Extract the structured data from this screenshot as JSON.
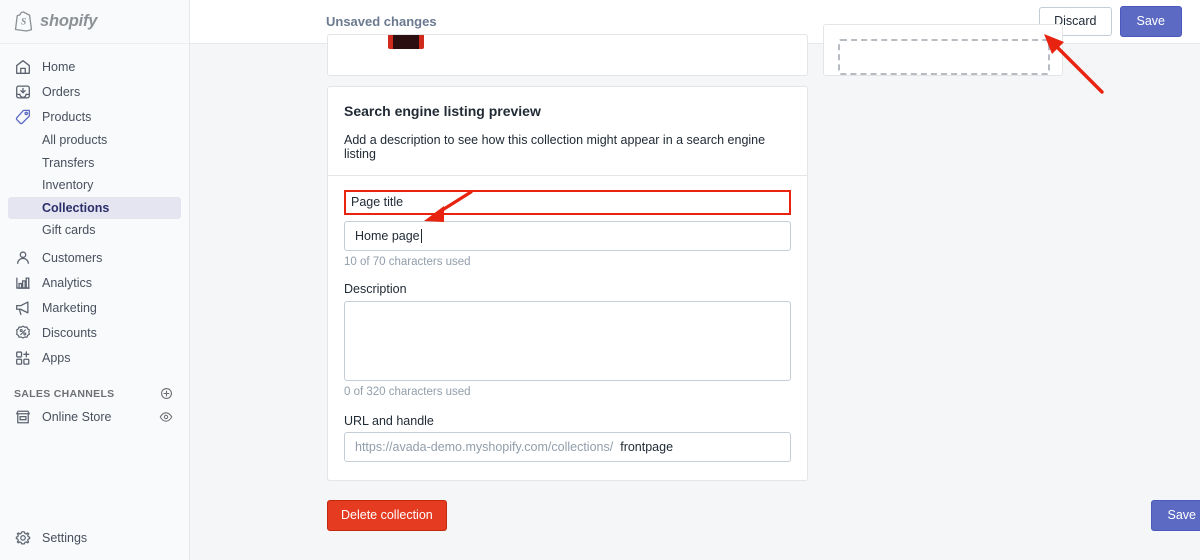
{
  "brand": {
    "name": "shopify",
    "logo_icon": "shopify-bag-icon"
  },
  "sidebar": {
    "items": [
      {
        "label": "Home",
        "icon": "home-icon",
        "type": "item"
      },
      {
        "label": "Orders",
        "icon": "orders-inbox-icon",
        "type": "item"
      },
      {
        "label": "Products",
        "icon": "products-tag-icon",
        "type": "item"
      },
      {
        "label": "All products",
        "type": "sub"
      },
      {
        "label": "Transfers",
        "type": "sub"
      },
      {
        "label": "Inventory",
        "type": "sub"
      },
      {
        "label": "Collections",
        "type": "sub",
        "active": true
      },
      {
        "label": "Gift cards",
        "type": "sub"
      },
      {
        "label": "Customers",
        "icon": "customers-person-icon",
        "type": "item"
      },
      {
        "label": "Analytics",
        "icon": "analytics-bar-chart-icon",
        "type": "item"
      },
      {
        "label": "Marketing",
        "icon": "marketing-megaphone-icon",
        "type": "item"
      },
      {
        "label": "Discounts",
        "icon": "discounts-percent-icon",
        "type": "item"
      },
      {
        "label": "Apps",
        "icon": "apps-grid-plus-icon",
        "type": "item"
      }
    ],
    "sales_channels": {
      "heading": "SALES CHANNELS",
      "add_icon": "plus-circle-icon",
      "items": [
        {
          "label": "Online Store",
          "icon": "online-store-icon",
          "action_icon": "eye-icon"
        }
      ]
    },
    "settings": {
      "label": "Settings",
      "icon": "gear-icon"
    }
  },
  "topbar": {
    "status_text": "Unsaved changes",
    "discard_label": "Discard",
    "save_label": "Save"
  },
  "seo_card": {
    "title": "Search engine listing preview",
    "subtitle": "Add a description to see how this collection might appear in a search engine listing",
    "page_title": {
      "label": "Page title",
      "value": "Home page",
      "placeholder": "",
      "counter": "10 of 70 characters used"
    },
    "description": {
      "label": "Description",
      "value": "",
      "placeholder": "",
      "counter": "0 of 320 characters used"
    },
    "url_handle": {
      "label": "URL and handle",
      "prefix": "https://avada-demo.myshopify.com/collections/",
      "value": "frontpage"
    }
  },
  "footer": {
    "delete_label": "Delete collection",
    "save_label": "Save"
  },
  "colors": {
    "accent": "#5c6ac4",
    "destructive": "#e43b21",
    "annotation": "#e8230f",
    "sidebar_bg": "#f9fafb",
    "page_bg": "#f4f6f8",
    "active_nav_bg": "#e4e5f0"
  }
}
